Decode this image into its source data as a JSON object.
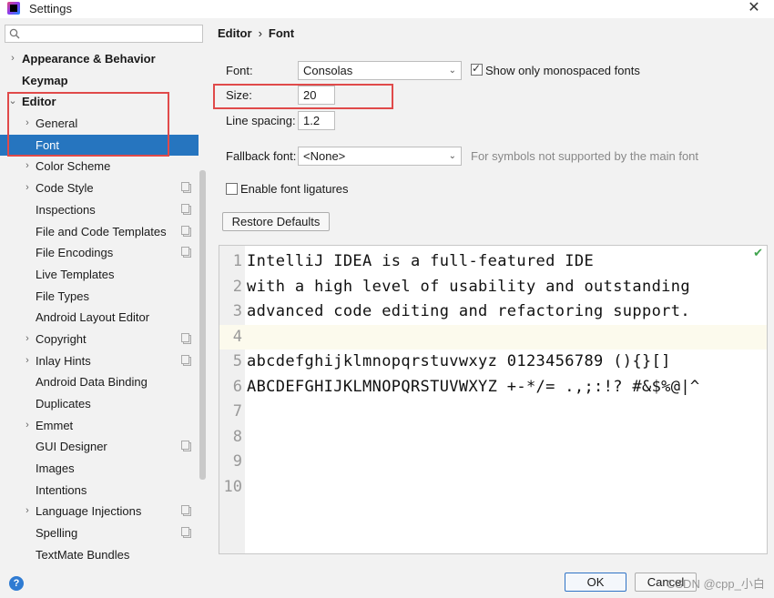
{
  "window": {
    "title": "Settings"
  },
  "search": {
    "placeholder": ""
  },
  "sidebar": {
    "items": [
      {
        "label": "Appearance & Behavior",
        "arrow": "›",
        "bold": true
      },
      {
        "label": "Keymap",
        "arrow": "",
        "bold": true
      },
      {
        "label": "Editor",
        "arrow": "⌄",
        "bold": true
      },
      {
        "label": "General",
        "arrow": "›"
      },
      {
        "label": "Font",
        "arrow": "",
        "selected": true
      },
      {
        "label": "Color Scheme",
        "arrow": "›"
      },
      {
        "label": "Code Style",
        "arrow": "›",
        "project": true
      },
      {
        "label": "Inspections",
        "arrow": "",
        "project": true
      },
      {
        "label": "File and Code Templates",
        "arrow": "",
        "project": true
      },
      {
        "label": "File Encodings",
        "arrow": "",
        "project": true
      },
      {
        "label": "Live Templates",
        "arrow": ""
      },
      {
        "label": "File Types",
        "arrow": ""
      },
      {
        "label": "Android Layout Editor",
        "arrow": ""
      },
      {
        "label": "Copyright",
        "arrow": "›",
        "project": true
      },
      {
        "label": "Inlay Hints",
        "arrow": "›",
        "project": true
      },
      {
        "label": "Android Data Binding",
        "arrow": ""
      },
      {
        "label": "Duplicates",
        "arrow": ""
      },
      {
        "label": "Emmet",
        "arrow": "›"
      },
      {
        "label": "GUI Designer",
        "arrow": "",
        "project": true
      },
      {
        "label": "Images",
        "arrow": ""
      },
      {
        "label": "Intentions",
        "arrow": ""
      },
      {
        "label": "Language Injections",
        "arrow": "›",
        "project": true
      },
      {
        "label": "Spelling",
        "arrow": "",
        "project": true
      },
      {
        "label": "TextMate Bundles",
        "arrow": ""
      }
    ]
  },
  "breadcrumb": {
    "parent": "Editor",
    "separator": "›",
    "current": "Font"
  },
  "font_settings": {
    "font_label": "Font:",
    "font_value": "Consolas",
    "mono_label": "Show only monospaced fonts",
    "mono_checked": true,
    "size_label": "Size:",
    "size_value": "20",
    "spacing_label": "Line spacing:",
    "spacing_value": "1.2",
    "fallback_label": "Fallback font:",
    "fallback_value": "<None>",
    "fallback_hint": "For symbols not supported by the main font",
    "ligatures_label": "Enable font ligatures",
    "ligatures_checked": false,
    "restore_label": "Restore Defaults"
  },
  "preview": {
    "lines": [
      {
        "num": "1",
        "text": "IntelliJ IDEA is a full-featured IDE"
      },
      {
        "num": "2",
        "text": "with a high level of usability and outstanding"
      },
      {
        "num": "3",
        "text": "advanced code editing and refactoring support."
      },
      {
        "num": "4",
        "text": "",
        "current": true
      },
      {
        "num": "5",
        "text": "abcdefghijklmnopqrstuvwxyz 0123456789 (){}[]"
      },
      {
        "num": "6",
        "text": "ABCDEFGHIJKLMNOPQRSTUVWXYZ +-*/= .,;:!? #&$%@|^"
      },
      {
        "num": "7",
        "text": ""
      },
      {
        "num": "8",
        "text": ""
      },
      {
        "num": "9",
        "text": ""
      },
      {
        "num": "10",
        "text": ""
      }
    ]
  },
  "footer": {
    "ok_label": "OK",
    "cancel_label": "Cancel",
    "watermark": "CSDN @cpp_小白",
    "help_symbol": "?"
  },
  "icons": {
    "search": "search-icon",
    "close": "close-icon",
    "check": "green-check-icon"
  },
  "colors": {
    "selection": "#2675bf",
    "highlight_box": "#e04a4a",
    "current_line": "#fcfaed"
  }
}
